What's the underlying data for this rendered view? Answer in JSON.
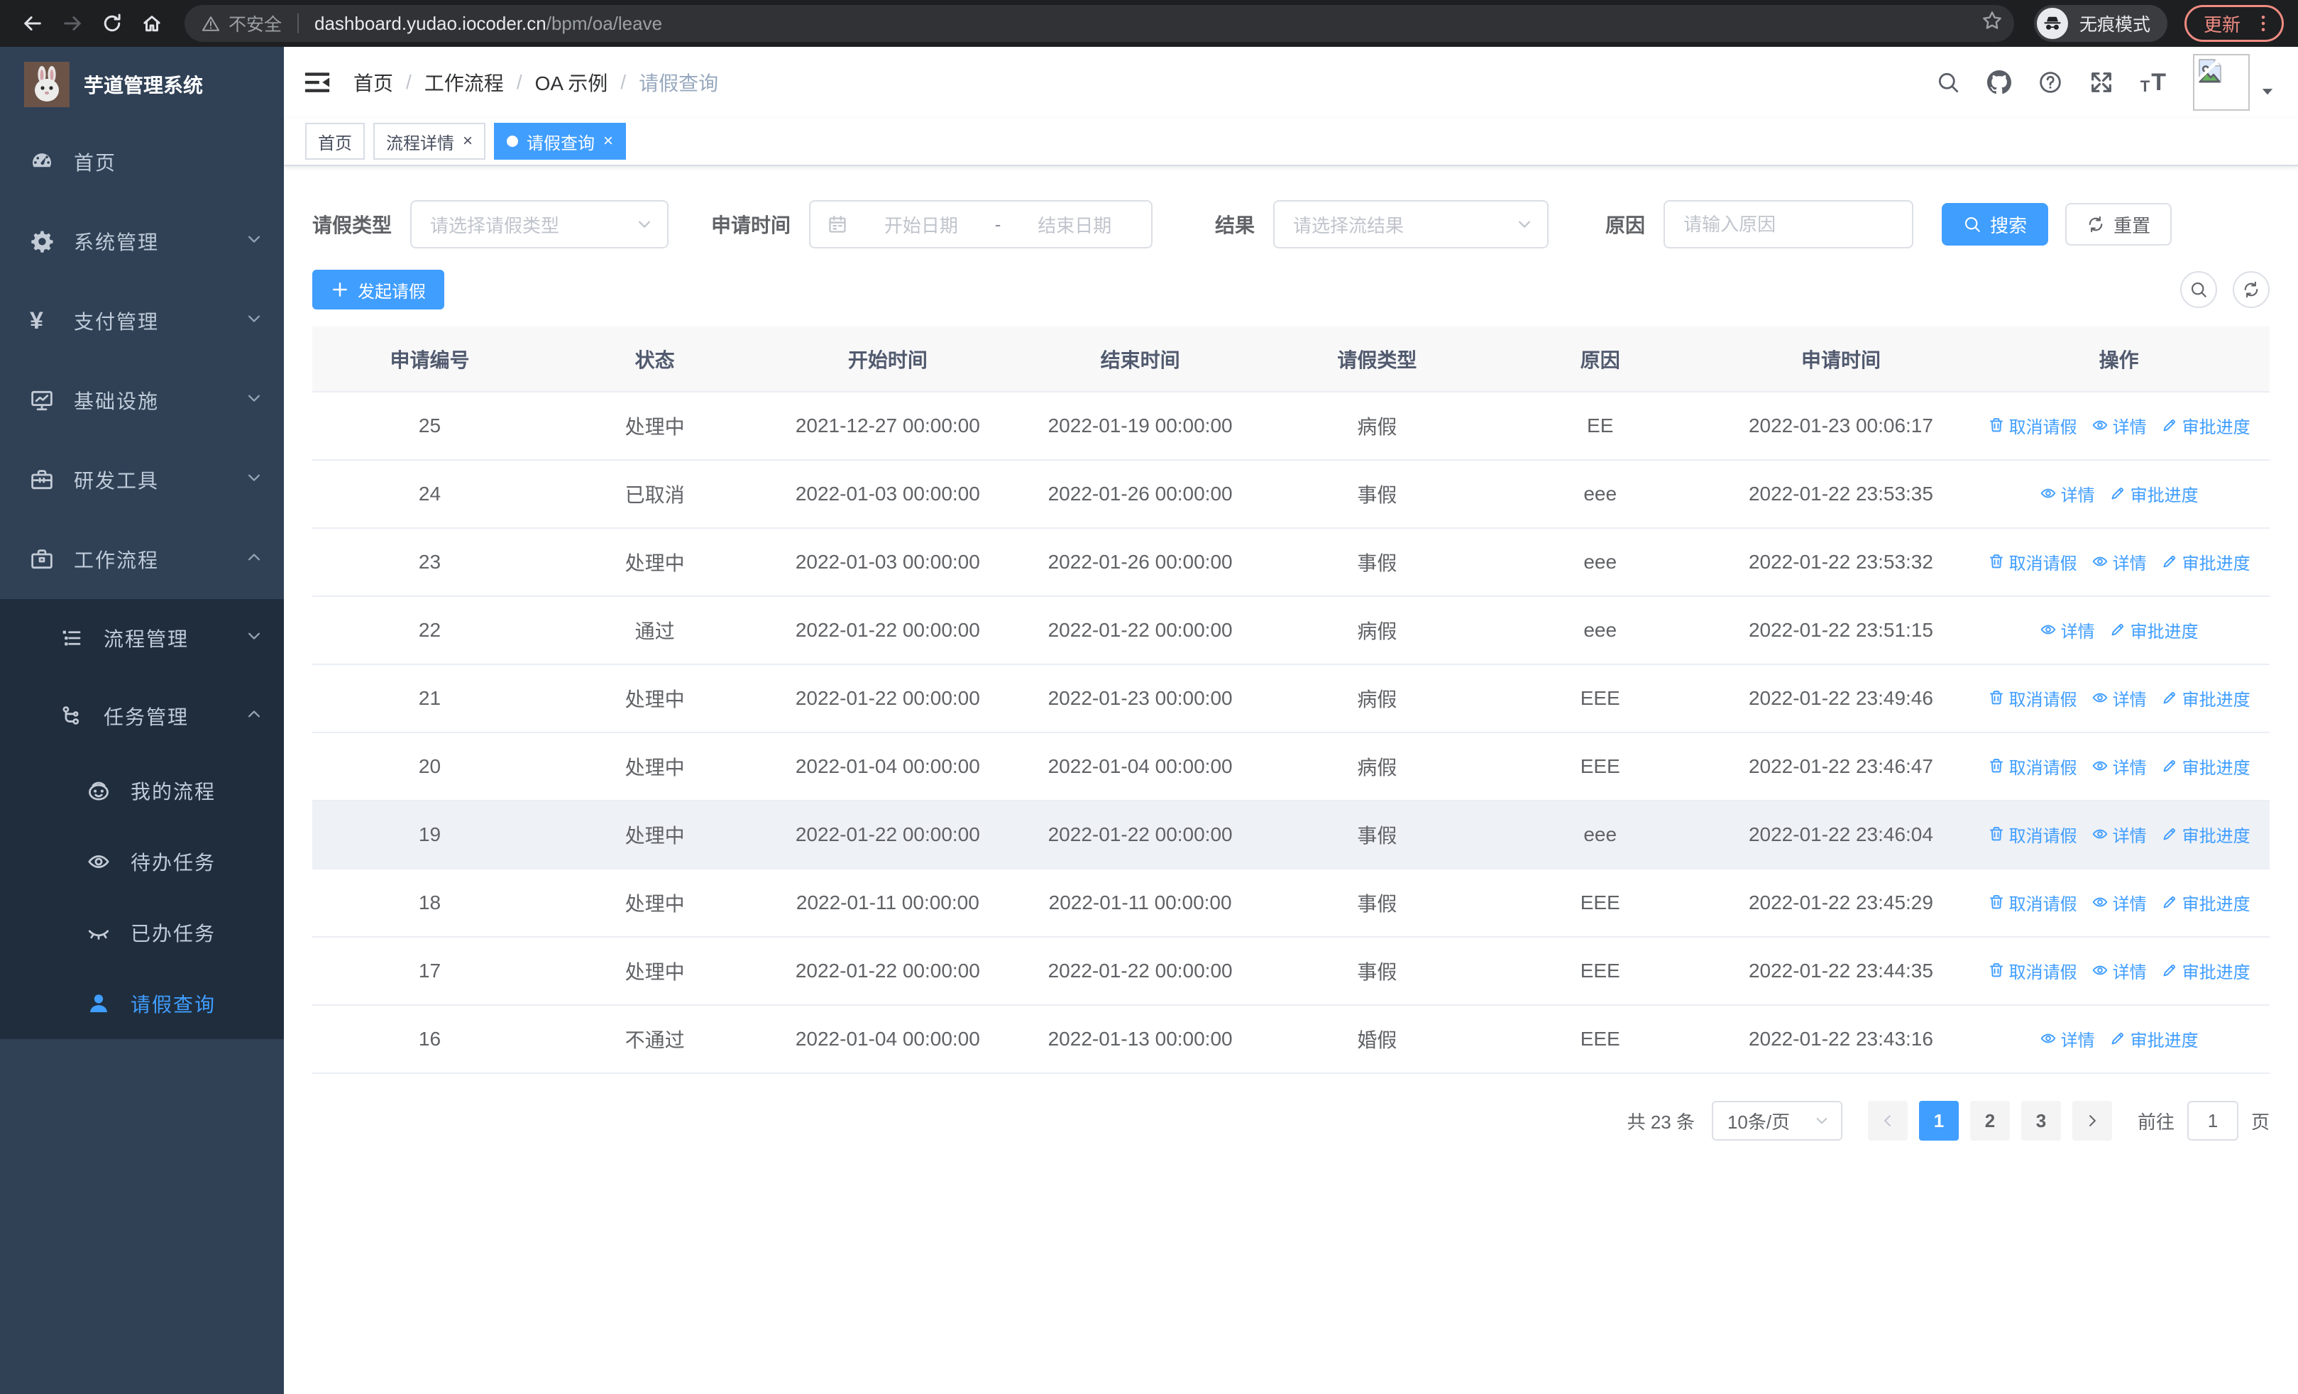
{
  "browser": {
    "security_label": "不安全",
    "url_host": "dashboard.yudao.iocoder.cn",
    "url_path": "/bpm/oa/leave",
    "incognito_label": "无痕模式",
    "update_label": "更新"
  },
  "sidebar": {
    "title": "芋道管理系统",
    "menu": [
      {
        "label": "首页",
        "icon": "dashboard-icon",
        "level": 1,
        "submenu": false,
        "active": false,
        "chevron": ""
      },
      {
        "label": "系统管理",
        "icon": "gear-icon",
        "level": 1,
        "submenu": false,
        "active": false,
        "chevron": "down"
      },
      {
        "label": "支付管理",
        "icon": "yen-icon",
        "level": 1,
        "submenu": false,
        "active": false,
        "chevron": "down"
      },
      {
        "label": "基础设施",
        "icon": "monitor-icon",
        "level": 1,
        "submenu": false,
        "active": false,
        "chevron": "down"
      },
      {
        "label": "研发工具",
        "icon": "toolbox-icon",
        "level": 1,
        "submenu": false,
        "active": false,
        "chevron": "down"
      },
      {
        "label": "工作流程",
        "icon": "briefcase-icon",
        "level": 1,
        "submenu": false,
        "active": false,
        "chevron": "up"
      },
      {
        "label": "流程管理",
        "icon": "tree-list-icon",
        "level": 2,
        "submenu": true,
        "active": false,
        "chevron": "down"
      },
      {
        "label": "任务管理",
        "icon": "flow-icon",
        "level": 2,
        "submenu": true,
        "active": false,
        "chevron": "up"
      },
      {
        "label": "我的流程",
        "icon": "face-icon",
        "level": 3,
        "submenu": true,
        "active": false,
        "chevron": ""
      },
      {
        "label": "待办任务",
        "icon": "eye-open-icon",
        "level": 3,
        "submenu": true,
        "active": false,
        "chevron": ""
      },
      {
        "label": "已办任务",
        "icon": "eye-closed-icon",
        "level": 3,
        "submenu": true,
        "active": false,
        "chevron": ""
      },
      {
        "label": "请假查询",
        "icon": "user-icon",
        "level": 3,
        "submenu": true,
        "active": true,
        "chevron": ""
      }
    ]
  },
  "breadcrumb": {
    "items": [
      "首页",
      "工作流程",
      "OA 示例",
      "请假查询"
    ]
  },
  "tabs": [
    {
      "label": "首页",
      "closable": false,
      "active": false
    },
    {
      "label": "流程详情",
      "closable": true,
      "active": false
    },
    {
      "label": "请假查询",
      "closable": true,
      "active": true
    }
  ],
  "filters": {
    "leave_type": {
      "label": "请假类型",
      "placeholder": "请选择请假类型"
    },
    "apply_time": {
      "label": "申请时间",
      "start_placeholder": "开始日期",
      "separator": "-",
      "end_placeholder": "结束日期"
    },
    "result": {
      "label": "结果",
      "placeholder": "请选择流结果"
    },
    "reason": {
      "label": "原因",
      "placeholder": "请输入原因"
    },
    "search_label": "搜索",
    "reset_label": "重置"
  },
  "toolbar": {
    "create_label": "发起请假"
  },
  "table": {
    "columns": [
      "申请编号",
      "状态",
      "开始时间",
      "结束时间",
      "请假类型",
      "原因",
      "申请时间",
      "操作"
    ],
    "action_labels": {
      "cancel": "取消请假",
      "detail": "详情",
      "progress": "审批进度"
    },
    "rows": [
      {
        "id": "25",
        "status": "处理中",
        "start": "2021-12-27 00:00:00",
        "end": "2022-01-19 00:00:00",
        "type": "病假",
        "reason": "EE",
        "applied": "2022-01-23 00:06:17",
        "actions": [
          "cancel",
          "detail",
          "progress"
        ],
        "hover": false
      },
      {
        "id": "24",
        "status": "已取消",
        "start": "2022-01-03 00:00:00",
        "end": "2022-01-26 00:00:00",
        "type": "事假",
        "reason": "eee",
        "applied": "2022-01-22 23:53:35",
        "actions": [
          "detail",
          "progress"
        ],
        "hover": false
      },
      {
        "id": "23",
        "status": "处理中",
        "start": "2022-01-03 00:00:00",
        "end": "2022-01-26 00:00:00",
        "type": "事假",
        "reason": "eee",
        "applied": "2022-01-22 23:53:32",
        "actions": [
          "cancel",
          "detail",
          "progress"
        ],
        "hover": false
      },
      {
        "id": "22",
        "status": "通过",
        "start": "2022-01-22 00:00:00",
        "end": "2022-01-22 00:00:00",
        "type": "病假",
        "reason": "eee",
        "applied": "2022-01-22 23:51:15",
        "actions": [
          "detail",
          "progress"
        ],
        "hover": false
      },
      {
        "id": "21",
        "status": "处理中",
        "start": "2022-01-22 00:00:00",
        "end": "2022-01-23 00:00:00",
        "type": "病假",
        "reason": "EEE",
        "applied": "2022-01-22 23:49:46",
        "actions": [
          "cancel",
          "detail",
          "progress"
        ],
        "hover": false
      },
      {
        "id": "20",
        "status": "处理中",
        "start": "2022-01-04 00:00:00",
        "end": "2022-01-04 00:00:00",
        "type": "病假",
        "reason": "EEE",
        "applied": "2022-01-22 23:46:47",
        "actions": [
          "cancel",
          "detail",
          "progress"
        ],
        "hover": false
      },
      {
        "id": "19",
        "status": "处理中",
        "start": "2022-01-22 00:00:00",
        "end": "2022-01-22 00:00:00",
        "type": "事假",
        "reason": "eee",
        "applied": "2022-01-22 23:46:04",
        "actions": [
          "cancel",
          "detail",
          "progress"
        ],
        "hover": true
      },
      {
        "id": "18",
        "status": "处理中",
        "start": "2022-01-11 00:00:00",
        "end": "2022-01-11 00:00:00",
        "type": "事假",
        "reason": "EEE",
        "applied": "2022-01-22 23:45:29",
        "actions": [
          "cancel",
          "detail",
          "progress"
        ],
        "hover": false
      },
      {
        "id": "17",
        "status": "处理中",
        "start": "2022-01-22 00:00:00",
        "end": "2022-01-22 00:00:00",
        "type": "事假",
        "reason": "EEE",
        "applied": "2022-01-22 23:44:35",
        "actions": [
          "cancel",
          "detail",
          "progress"
        ],
        "hover": false
      },
      {
        "id": "16",
        "status": "不通过",
        "start": "2022-01-04 00:00:00",
        "end": "2022-01-13 00:00:00",
        "type": "婚假",
        "reason": "EEE",
        "applied": "2022-01-22 23:43:16",
        "actions": [
          "detail",
          "progress"
        ],
        "hover": false
      }
    ]
  },
  "pagination": {
    "total_text": "共 23 条",
    "page_size": "10条/页",
    "pages": [
      "1",
      "2",
      "3"
    ],
    "active_page": "1",
    "goto_label": "前往",
    "goto_value": "1",
    "page_unit": "页"
  },
  "colors": {
    "primary": "#409EFF",
    "sidebar_bg": "#304156",
    "submenu_bg": "#1F2D3D",
    "update_accent": "#F08B82",
    "table_header_bg": "#F8F8F9"
  }
}
